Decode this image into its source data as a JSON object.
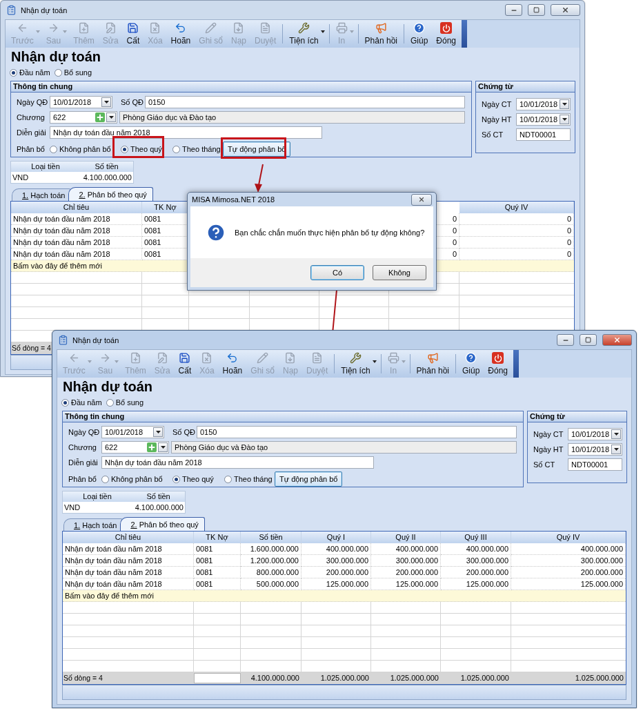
{
  "windows": [
    {
      "title": "Nhận dự toán",
      "active": false,
      "toolbar": [
        [
          {
            "label": "Trước",
            "disabled": true,
            "dropdown": true
          },
          {
            "label": "Sau",
            "disabled": true,
            "dropdown": true
          },
          {
            "label": "Thêm",
            "disabled": true,
            "dropdown": false
          },
          {
            "label": "Sửa",
            "disabled": true,
            "dropdown": false
          },
          {
            "label": "Cất",
            "disabled": false,
            "dropdown": false
          },
          {
            "label": "Xóa",
            "disabled": true,
            "dropdown": false
          },
          {
            "label": "Hoãn",
            "disabled": false,
            "dropdown": false
          },
          {
            "label": "Ghi sổ",
            "disabled": true,
            "dropdown": false
          },
          {
            "label": "Nạp",
            "disabled": true,
            "dropdown": false
          },
          {
            "label": "Duyệt",
            "disabled": true,
            "dropdown": false
          }
        ],
        [
          {
            "label": "Tiện ích",
            "disabled": false,
            "dropdown": true
          }
        ],
        [
          {
            "label": "In",
            "disabled": true,
            "dropdown": true
          }
        ],
        [
          {
            "label": "Phản hồi",
            "disabled": false,
            "dropdown": false
          }
        ],
        [
          {
            "label": "Giúp",
            "disabled": false,
            "dropdown": false
          },
          {
            "label": "Đóng",
            "disabled": false,
            "dropdown": false
          }
        ]
      ],
      "heading": "Nhận dự toán",
      "mode_options": [
        {
          "label": "Đầu năm",
          "selected": true
        },
        {
          "label": "Bổ sung",
          "selected": false
        }
      ],
      "general": {
        "title": "Thông tin chung",
        "ngay_qd": {
          "label": "Ngày QĐ",
          "value": "10/01/2018"
        },
        "so_qd": {
          "label": "Số QĐ",
          "value": "0150"
        },
        "chuong": {
          "label": "Chương",
          "value": "622",
          "description": "Phòng Giáo dục và Đào tạo"
        },
        "dien_giai": {
          "label": "Diễn giải",
          "value": "Nhận dự toán đầu năm 2018"
        },
        "phan_bo": {
          "label": "Phân bổ",
          "options": [
            {
              "label": "Không phân bổ",
              "selected": false
            },
            {
              "label": "Theo quý",
              "selected": true
            },
            {
              "label": "Theo tháng",
              "selected": false
            }
          ],
          "button": "Tự động phân bổ"
        }
      },
      "voucher": {
        "title": "Chứng từ",
        "fields": [
          {
            "label": "Ngày CT",
            "value": "10/01/2018",
            "kind": "date"
          },
          {
            "label": "Ngày HT",
            "value": "10/01/2018",
            "kind": "date"
          },
          {
            "label": "Số CT",
            "value": "NDT00001",
            "kind": "text"
          }
        ]
      },
      "currency": {
        "columns": [
          "Loại tiền",
          "Số tiền"
        ],
        "row": [
          "VND",
          "4.100.000.000"
        ]
      },
      "tabs": [
        {
          "label": "1. Hạch toán",
          "selected": false
        },
        {
          "label": "2. Phân bổ theo quý",
          "selected": true
        }
      ],
      "grid": {
        "columns": [
          "Chỉ tiêu",
          "TK Nợ",
          null,
          null,
          null,
          null,
          "Quý IV"
        ],
        "rows": [
          [
            "Nhận dự toán đầu năm 2018",
            "0081",
            null,
            null,
            null,
            "0",
            "0"
          ],
          [
            "Nhận dự toán đầu năm 2018",
            "0081",
            null,
            null,
            null,
            "0",
            "0"
          ],
          [
            "Nhận dự toán đầu năm 2018",
            "0081",
            null,
            null,
            null,
            "0",
            "0"
          ],
          [
            "Nhận dự toán đầu năm 2018",
            "0081",
            null,
            null,
            null,
            "0",
            "0"
          ]
        ],
        "add_row": "Bấm vào đây để thêm mới",
        "footer": {
          "count": "Số dòng = 4"
        }
      }
    },
    {
      "title": "Nhận dự toán",
      "active": true,
      "toolbar": [
        [
          {
            "label": "Trước",
            "disabled": true,
            "dropdown": true
          },
          {
            "label": "Sau",
            "disabled": true,
            "dropdown": true
          },
          {
            "label": "Thêm",
            "disabled": true,
            "dropdown": false
          },
          {
            "label": "Sửa",
            "disabled": true,
            "dropdown": false
          },
          {
            "label": "Cất",
            "disabled": false,
            "dropdown": false
          },
          {
            "label": "Xóa",
            "disabled": true,
            "dropdown": false
          },
          {
            "label": "Hoãn",
            "disabled": false,
            "dropdown": false
          },
          {
            "label": "Ghi sổ",
            "disabled": true,
            "dropdown": false
          },
          {
            "label": "Nạp",
            "disabled": true,
            "dropdown": false
          },
          {
            "label": "Duyệt",
            "disabled": true,
            "dropdown": false
          }
        ],
        [
          {
            "label": "Tiện ích",
            "disabled": false,
            "dropdown": true
          }
        ],
        [
          {
            "label": "In",
            "disabled": true,
            "dropdown": true
          }
        ],
        [
          {
            "label": "Phản hồi",
            "disabled": false,
            "dropdown": false
          }
        ],
        [
          {
            "label": "Giúp",
            "disabled": false,
            "dropdown": false
          },
          {
            "label": "Đóng",
            "disabled": false,
            "dropdown": false
          }
        ]
      ],
      "heading": "Nhận dự toán",
      "mode_options": [
        {
          "label": "Đầu năm",
          "selected": true
        },
        {
          "label": "Bổ sung",
          "selected": false
        }
      ],
      "general": {
        "title": "Thông tin chung",
        "ngay_qd": {
          "label": "Ngày QĐ",
          "value": "10/01/2018"
        },
        "so_qd": {
          "label": "Số QĐ",
          "value": "0150"
        },
        "chuong": {
          "label": "Chương",
          "value": "622",
          "description": "Phòng Giáo dục và Đào tạo"
        },
        "dien_giai": {
          "label": "Diễn giải",
          "value": "Nhận dự toán đầu năm 2018"
        },
        "phan_bo": {
          "label": "Phân bổ",
          "options": [
            {
              "label": "Không phân bổ",
              "selected": false
            },
            {
              "label": "Theo quý",
              "selected": true
            },
            {
              "label": "Theo tháng",
              "selected": false
            }
          ],
          "button": "Tự động phân bổ"
        }
      },
      "voucher": {
        "title": "Chứng từ",
        "fields": [
          {
            "label": "Ngày CT",
            "value": "10/01/2018",
            "kind": "date"
          },
          {
            "label": "Ngày HT",
            "value": "10/01/2018",
            "kind": "date"
          },
          {
            "label": "Số CT",
            "value": "NDT00001",
            "kind": "text"
          }
        ]
      },
      "currency": {
        "columns": [
          "Loại tiền",
          "Số tiền"
        ],
        "row": [
          "VND",
          "4.100.000.000"
        ]
      },
      "tabs": [
        {
          "label": "1. Hạch toán",
          "selected": false
        },
        {
          "label": "2. Phân bổ theo quý",
          "selected": true
        }
      ],
      "grid": {
        "columns": [
          "Chỉ tiêu",
          "TK Nợ",
          "Số tiền",
          "Quý I",
          "Quý II",
          "Quý III",
          "Quý IV"
        ],
        "rows": [
          [
            "Nhận dự toán đầu năm 2018",
            "0081",
            "1.600.000.000",
            "400.000.000",
            "400.000.000",
            "400.000.000",
            "400.000.000"
          ],
          [
            "Nhận dự toán đầu năm 2018",
            "0081",
            "1.200.000.000",
            "300.000.000",
            "300.000.000",
            "300.000.000",
            "300.000.000"
          ],
          [
            "Nhận dự toán đầu năm 2018",
            "0081",
            "800.000.000",
            "200.000.000",
            "200.000.000",
            "200.000.000",
            "200.000.000"
          ],
          [
            "Nhận dự toán đầu năm 2018",
            "0081",
            "500.000.000",
            "125.000.000",
            "125.000.000",
            "125.000.000",
            "125.000.000"
          ]
        ],
        "add_row": "Bấm vào đây để thêm mới",
        "footer": {
          "count": "Số dòng = 4",
          "totals": [
            "4.100.000.000",
            "1.025.000.000",
            "1.025.000.000",
            "1.025.000.000",
            "1.025.000.000"
          ]
        }
      }
    }
  ],
  "dialog": {
    "title": "MISA Mimosa.NET 2018",
    "message": "Bạn chắc chắn muốn thực hiện phân bổ tự động không?",
    "buttons": [
      {
        "label": "Có",
        "default": true
      },
      {
        "label": "Không",
        "default": false
      }
    ]
  }
}
